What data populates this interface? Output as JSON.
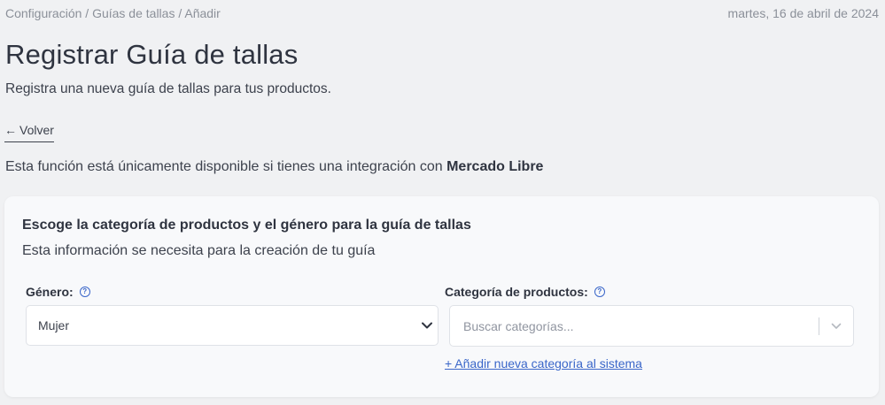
{
  "breadcrumb": {
    "items": [
      "Configuración",
      "Guías de tallas",
      "Añadir"
    ],
    "separator": " / "
  },
  "date": "martes, 16 de abril de 2024",
  "header": {
    "title": "Registrar Guía de tallas",
    "subtitle": "Registra una nueva guía de tallas para tus productos."
  },
  "back": {
    "arrow": "←",
    "label": "Volver"
  },
  "notice": {
    "text": "Esta función está únicamente disponible si tienes una integración con ",
    "highlight": "Mercado Libre"
  },
  "card": {
    "title": "Escoge la categoría de productos y el género para la guía de tallas",
    "description": "Esta información se necesita para la creación de tu guía",
    "gender": {
      "label": "Género:",
      "value": "Mujer",
      "help_icon": "question-circle-icon"
    },
    "category": {
      "label": "Categoría de productos:",
      "placeholder": "Buscar categorías...",
      "help_icon": "question-circle-icon"
    },
    "add_category_link": "+ Añadir nueva categoría al sistema"
  },
  "colors": {
    "background": "#f0f1f3",
    "card": "#f8f9fb",
    "accent": "#3a66c9",
    "text": "#3d424d"
  }
}
